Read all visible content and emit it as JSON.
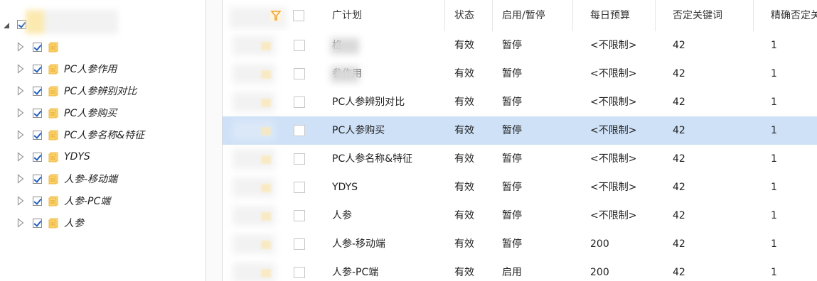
{
  "tree": {
    "root": {
      "label": "",
      "expanded": true
    },
    "items": [
      {
        "label": "",
        "checked": true
      },
      {
        "label": "PC人参作用",
        "checked": true
      },
      {
        "label": "PC人参辨别对比",
        "checked": true
      },
      {
        "label": "PC人参购买",
        "checked": true
      },
      {
        "label": "PC人参名称&特征",
        "checked": true
      },
      {
        "label": "YDYS",
        "checked": true
      },
      {
        "label": "人参-移动端",
        "checked": true
      },
      {
        "label": "人参-PC端",
        "checked": true
      },
      {
        "label": "人参",
        "checked": true
      }
    ]
  },
  "table": {
    "columns": [
      "广计划",
      "状态",
      "启用/暂停",
      "每日预算",
      "否定关键词",
      "精确否定关"
    ],
    "rows": [
      {
        "plan": "格",
        "status": "有效",
        "enabled": "暂停",
        "budget": "<不限制>",
        "neg": "42",
        "exact_neg": "1",
        "selected": false
      },
      {
        "plan": "参作用",
        "status": "有效",
        "enabled": "暂停",
        "budget": "<不限制>",
        "neg": "42",
        "exact_neg": "1",
        "selected": false
      },
      {
        "plan": "PC人参辨别对比",
        "status": "有效",
        "enabled": "暂停",
        "budget": "<不限制>",
        "neg": "42",
        "exact_neg": "1",
        "selected": false
      },
      {
        "plan": "PC人参购买",
        "status": "有效",
        "enabled": "暂停",
        "budget": "<不限制>",
        "neg": "42",
        "exact_neg": "1",
        "selected": true
      },
      {
        "plan": "PC人参名称&特征",
        "status": "有效",
        "enabled": "暂停",
        "budget": "<不限制>",
        "neg": "42",
        "exact_neg": "1",
        "selected": false
      },
      {
        "plan": "YDYS",
        "status": "有效",
        "enabled": "暂停",
        "budget": "<不限制>",
        "neg": "42",
        "exact_neg": "1",
        "selected": false
      },
      {
        "plan": "人参",
        "status": "有效",
        "enabled": "暂停",
        "budget": "<不限制>",
        "neg": "42",
        "exact_neg": "1",
        "selected": false
      },
      {
        "plan": "人参-移动端",
        "status": "有效",
        "enabled": "暂停",
        "budget": "200",
        "neg": "42",
        "exact_neg": "1",
        "selected": false
      },
      {
        "plan": "人参-PC端",
        "status": "有效",
        "enabled": "启用",
        "budget": "200",
        "neg": "42",
        "exact_neg": "1",
        "selected": false
      }
    ]
  },
  "colors": {
    "selected_row": "#cfe1f7",
    "folder": "#f5b941",
    "check": "#1f5fbf"
  },
  "icons": {
    "expand": "triangle-right-icon",
    "expanded": "triangle-down-icon",
    "folder": "folder-icon",
    "filter": "filter-icon"
  }
}
